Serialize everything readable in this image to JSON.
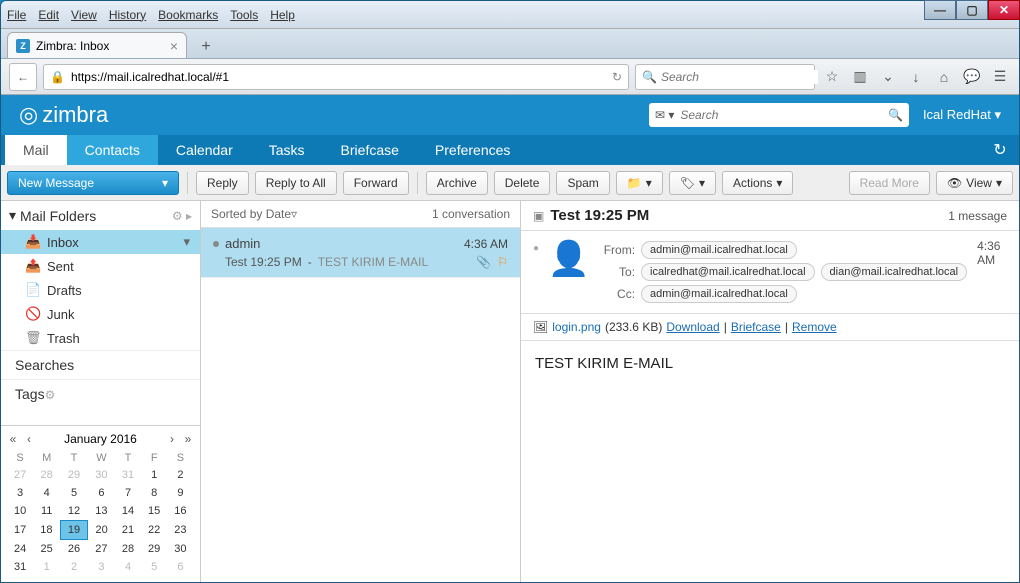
{
  "window": {
    "menus": [
      "File",
      "Edit",
      "View",
      "History",
      "Bookmarks",
      "Tools",
      "Help"
    ]
  },
  "tab": {
    "title": "Zimbra: Inbox"
  },
  "url": {
    "value": "https://mail.icalredhat.local/#1"
  },
  "browser_search": {
    "placeholder": "Search"
  },
  "zimbra": {
    "brand": "zimbra",
    "search_placeholder": "Search",
    "user": "Ical RedHat"
  },
  "tabs": {
    "items": [
      "Mail",
      "Contacts",
      "Calendar",
      "Tasks",
      "Briefcase",
      "Preferences"
    ],
    "active": 0
  },
  "toolbar": {
    "new_message": "New Message",
    "reply": "Reply",
    "reply_all": "Reply to All",
    "forward": "Forward",
    "archive": "Archive",
    "delete": "Delete",
    "spam": "Spam",
    "actions": "Actions",
    "read_more": "Read More",
    "view": "View"
  },
  "sidebar": {
    "header": "Mail Folders",
    "folders": [
      {
        "name": "Inbox",
        "icon": "inbox"
      },
      {
        "name": "Sent",
        "icon": "sent"
      },
      {
        "name": "Drafts",
        "icon": "drafts"
      },
      {
        "name": "Junk",
        "icon": "junk"
      },
      {
        "name": "Trash",
        "icon": "trash"
      }
    ],
    "searches": "Searches",
    "tags": "Tags"
  },
  "calendar": {
    "title": "January 2016",
    "dow": [
      "S",
      "M",
      "T",
      "W",
      "T",
      "F",
      "S"
    ],
    "rows": [
      [
        {
          "d": "27",
          "dim": true
        },
        {
          "d": "28",
          "dim": true
        },
        {
          "d": "29",
          "dim": true
        },
        {
          "d": "30",
          "dim": true
        },
        {
          "d": "31",
          "dim": true
        },
        {
          "d": "1"
        },
        {
          "d": "2"
        }
      ],
      [
        {
          "d": "3"
        },
        {
          "d": "4"
        },
        {
          "d": "5"
        },
        {
          "d": "6"
        },
        {
          "d": "7"
        },
        {
          "d": "8"
        },
        {
          "d": "9"
        }
      ],
      [
        {
          "d": "10"
        },
        {
          "d": "11"
        },
        {
          "d": "12"
        },
        {
          "d": "13"
        },
        {
          "d": "14"
        },
        {
          "d": "15"
        },
        {
          "d": "16"
        }
      ],
      [
        {
          "d": "17"
        },
        {
          "d": "18"
        },
        {
          "d": "19",
          "today": true
        },
        {
          "d": "20"
        },
        {
          "d": "21"
        },
        {
          "d": "22"
        },
        {
          "d": "23"
        }
      ],
      [
        {
          "d": "24"
        },
        {
          "d": "25"
        },
        {
          "d": "26"
        },
        {
          "d": "27"
        },
        {
          "d": "28"
        },
        {
          "d": "29"
        },
        {
          "d": "30"
        }
      ],
      [
        {
          "d": "31"
        },
        {
          "d": "1",
          "dim": true
        },
        {
          "d": "2",
          "dim": true
        },
        {
          "d": "3",
          "dim": true
        },
        {
          "d": "4",
          "dim": true
        },
        {
          "d": "5",
          "dim": true
        },
        {
          "d": "6",
          "dim": true
        }
      ]
    ]
  },
  "msglist": {
    "sort_label": "Sorted by Date",
    "count_label": "1 conversation",
    "items": [
      {
        "from": "admin",
        "time": "4:36 AM",
        "subject": "Test 19:25 PM",
        "snippet": "TEST KIRIM E-MAIL"
      }
    ]
  },
  "reading": {
    "subject": "Test 19:25 PM",
    "message_count": "1 message",
    "time": "4:36 AM",
    "from_label": "From:",
    "to_label": "To:",
    "cc_label": "Cc:",
    "from": "admin@mail.icalredhat.local",
    "to": [
      "icalredhat@mail.icalredhat.local",
      "dian@mail.icalredhat.local"
    ],
    "cc": "admin@mail.icalredhat.local",
    "attachment": {
      "name": "login.png",
      "size": "(233.6 KB)",
      "download": "Download",
      "briefcase": "Briefcase",
      "remove": "Remove"
    },
    "body": "TEST KIRIM E-MAIL"
  }
}
